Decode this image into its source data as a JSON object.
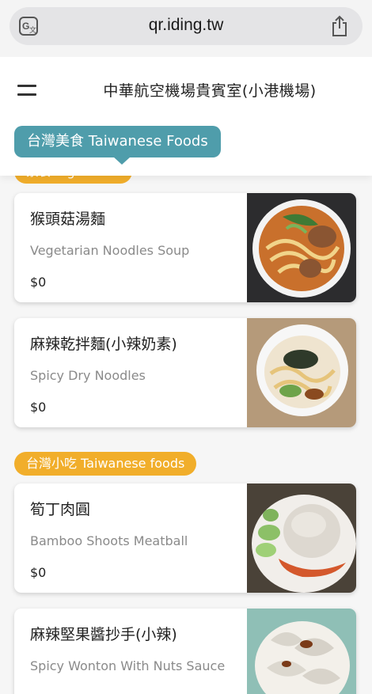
{
  "browser": {
    "url": "qr.iding.tw",
    "translate_icon": "translate-icon",
    "share_icon": "share-icon"
  },
  "header": {
    "menu_icon": "hamburger-menu-icon",
    "title": "中華航空機場貴賓室(小港機場)"
  },
  "category_tab": {
    "label": "台灣美食 Taiwanese Foods",
    "color": "#4f9dab"
  },
  "sections": [
    {
      "label": "素食Vegetarian",
      "color": "#f1ae2b",
      "items": [
        {
          "name": "猴頭菇湯麵",
          "english": "Vegetarian Noodles Soup",
          "price": "$0",
          "photo": "mushroom-noodle-soup-photo"
        },
        {
          "name": "麻辣乾拌麵(小辣奶素)",
          "english": "Spicy Dry Noodles",
          "price": "$0",
          "photo": "spicy-dry-noodles-photo"
        }
      ]
    },
    {
      "label": "台灣小吃 Taiwanese foods",
      "color": "#f1ae2b",
      "items": [
        {
          "name": "筍丁肉圓",
          "english": "Bamboo Shoots Meatball",
          "price": "$0",
          "photo": "meatball-photo"
        },
        {
          "name": "麻辣堅果醬抄手(小辣)",
          "english": "Spicy Wonton With Nuts Sauce",
          "price": "",
          "photo": "wonton-photo"
        }
      ]
    }
  ]
}
